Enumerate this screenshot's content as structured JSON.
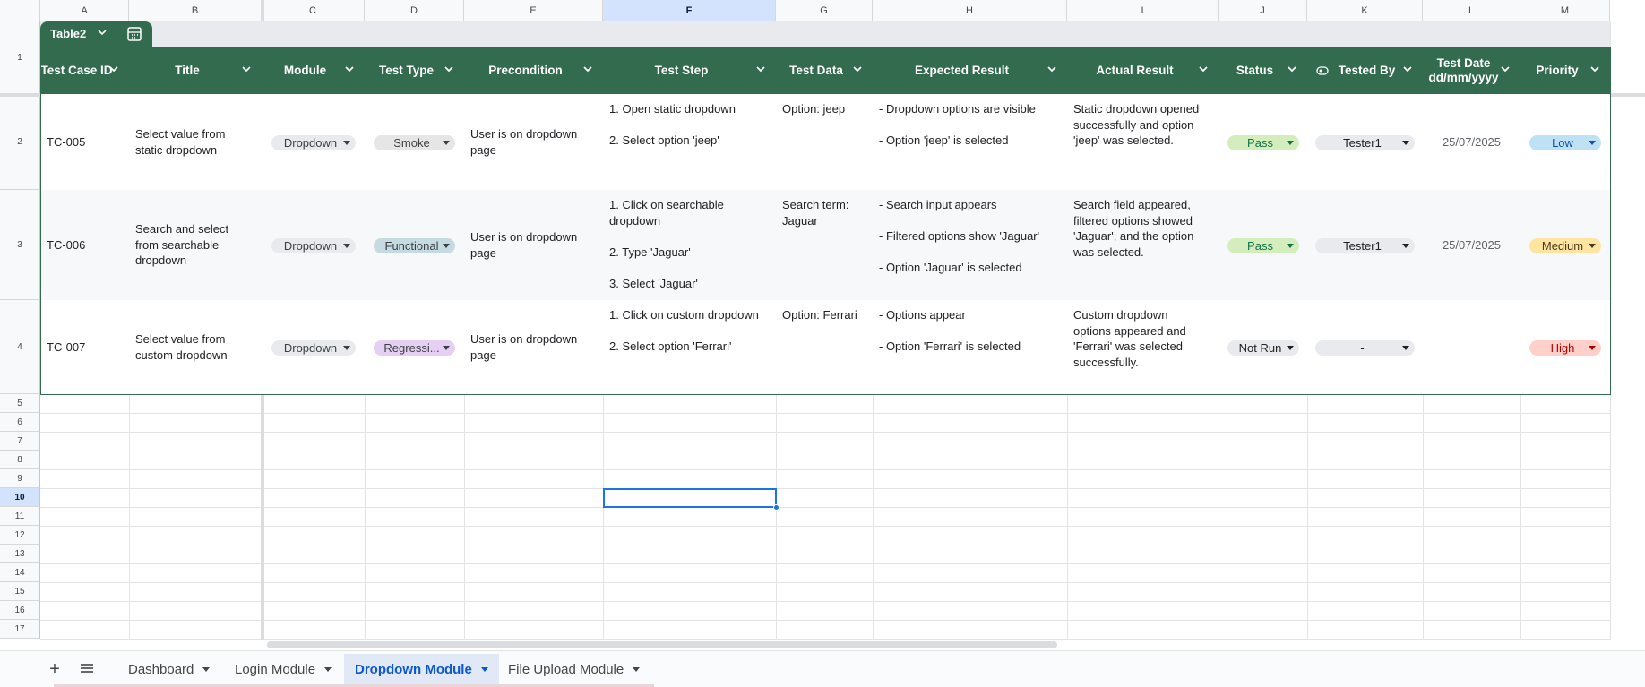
{
  "sheet": {
    "columns": [
      "A",
      "B",
      "C",
      "D",
      "E",
      "F",
      "G",
      "H",
      "I",
      "J",
      "K",
      "L",
      "M"
    ],
    "active_column": "F",
    "rows": [
      "1",
      "2",
      "3",
      "4",
      "5",
      "6",
      "7",
      "8",
      "9",
      "10",
      "11",
      "12",
      "13",
      "14",
      "15",
      "16",
      "17"
    ],
    "active_row": "10"
  },
  "table": {
    "name": "Table2",
    "header_color": "#336b4f",
    "headers": [
      "Test Case ID",
      "Title",
      "Module",
      "Test Type",
      "Precondition",
      "Test Step",
      "Test Data",
      "Expected Result",
      "Actual Result",
      "Status",
      "Tested By",
      "Test Date\ndd/mm/yyyy",
      "Priority"
    ],
    "rows": [
      {
        "id": "TC-005",
        "title": "Select value from\nstatic dropdown",
        "module": "Dropdown",
        "test_type": "Smoke",
        "precondition": "User is on dropdown\npage",
        "test_step": "1. Open static dropdown\n\n2. Select option 'jeep'",
        "test_data": "Option: jeep",
        "expected": "- Dropdown options are visible\n\n- Option 'jeep' is selected",
        "actual": "Static dropdown opened\nsuccessfully and option\n'jeep' was selected.",
        "status": "Pass",
        "tested_by": "Tester1",
        "test_date": "25/07/2025",
        "priority": "Low"
      },
      {
        "id": "TC-006",
        "title": "Search and select\nfrom searchable\ndropdown",
        "module": "Dropdown",
        "test_type": "Functional",
        "precondition": "User is on dropdown\npage",
        "test_step": "1. Click on searchable\ndropdown\n\n2. Type 'Jaguar'\n\n3. Select 'Jaguar'",
        "test_data": "Search term:\nJaguar",
        "expected": "- Search input appears\n\n- Filtered options show 'Jaguar'\n\n- Option 'Jaguar' is selected",
        "actual": "Search field appeared,\nfiltered options showed\n'Jaguar', and the option\nwas selected.",
        "status": "Pass",
        "tested_by": "Tester1",
        "test_date": "25/07/2025",
        "priority": "Medium"
      },
      {
        "id": "TC-007",
        "title": "Select value from\ncustom dropdown",
        "module": "Dropdown",
        "test_type": "Regressi...",
        "precondition": "User is on dropdown\npage",
        "test_step": "1. Click on custom dropdown\n\n2. Select option 'Ferrari'",
        "test_data": "Option: Ferrari",
        "expected": "- Options appear\n\n- Option 'Ferrari' is selected",
        "actual": "Custom dropdown\noptions appeared and\n'Ferrari' was selected\nsuccessfully.",
        "status": "Not Run",
        "tested_by": "-",
        "test_date": "",
        "priority": "High"
      }
    ]
  },
  "chip_colors": {
    "neutral": "#e8eaed",
    "smoke": "#e6e6e6",
    "functional": "#c6dbe1",
    "regression": "#e5cff2",
    "pass": "#d4edbc",
    "pass_text": "#11734b",
    "low": "#bfe1f6",
    "medium": "#ffe5a0",
    "high": "#ffcfc9",
    "high_text": "#b10202"
  },
  "tabs": {
    "add_icon": "plus-icon",
    "menu_icon": "all-sheets-icon",
    "items": [
      "Dashboard",
      "Login Module",
      "Dropdown Module",
      "File Upload Module"
    ],
    "active": "Dropdown Module"
  }
}
